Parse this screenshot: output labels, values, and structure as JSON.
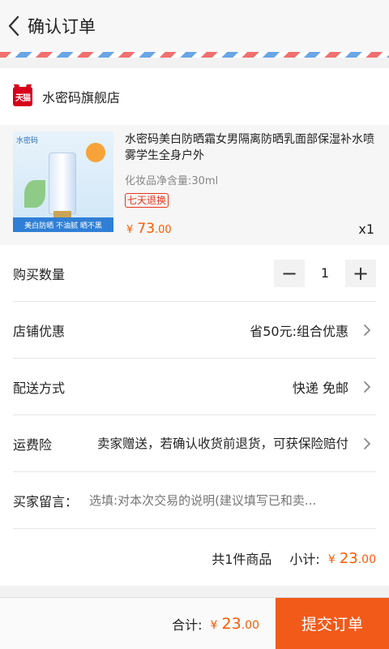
{
  "header": {
    "title": "确认订单",
    "back_icon": "chevron-left-icon"
  },
  "shop": {
    "logo_text": "天猫",
    "name": "水密码旗舰店",
    "product": {
      "image_brand": "水密码",
      "image_banner": "美白防晒  不油腻  晒不黑",
      "title": "水密码美白防晒霜女男隔离防晒乳面部保湿补水喷雾学生全身户外",
      "spec": "化妆品净含量:30ml",
      "return_badge": "七天退换",
      "price_currency": "¥",
      "price_int": "73",
      "price_dec": ".00",
      "quantity_mark": "x1"
    }
  },
  "options": {
    "quantity": {
      "label": "购买数量",
      "minus": "−",
      "value": "1",
      "plus": "+"
    },
    "discount": {
      "label": "店铺优惠",
      "value": "省50元:组合优惠"
    },
    "delivery": {
      "label": "配送方式",
      "value": "快递 免邮"
    },
    "insurance": {
      "label": "运费险",
      "value": "卖家赠送，若确认收货前退货，可获保险赔付"
    },
    "note": {
      "label": "买家留言：",
      "placeholder": "选填:对本次交易的说明(建议填写已和卖..."
    },
    "summary": {
      "count_text": "共1件商品",
      "subtotal_label": "小计:",
      "currency": "¥",
      "int": "23",
      "dec": ".00"
    }
  },
  "bottom_bar": {
    "total_label": "合计:",
    "currency": "¥",
    "int": "23",
    "dec": ".00",
    "submit_label": "提交订单"
  },
  "colors": {
    "accent": "#f25a1a",
    "price": "#ff5a00",
    "badge": "#e8381c",
    "tmall": "#d8001a"
  }
}
